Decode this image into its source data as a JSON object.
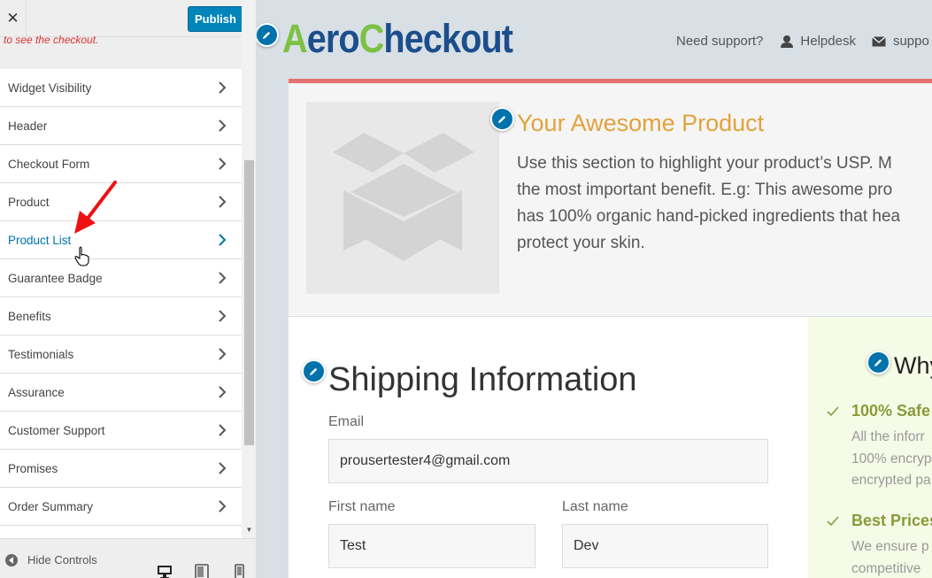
{
  "sidebar": {
    "close_label": "✕",
    "publish_label": "Publish",
    "notice": "to see the checkout.",
    "items": [
      {
        "label": "Widget Visibility"
      },
      {
        "label": "Header"
      },
      {
        "label": "Checkout Form"
      },
      {
        "label": "Product"
      },
      {
        "label": "Product List",
        "active": true
      },
      {
        "label": "Guarantee Badge"
      },
      {
        "label": "Benefits"
      },
      {
        "label": "Testimonials"
      },
      {
        "label": "Assurance"
      },
      {
        "label": "Customer Support"
      },
      {
        "label": "Promises"
      },
      {
        "label": "Order Summary"
      }
    ],
    "hide_controls": "Hide Controls",
    "devices": [
      "desktop-icon",
      "tablet-icon",
      "mobile-icon"
    ]
  },
  "preview": {
    "logo": {
      "first": "A",
      "mid": "ero",
      "accent": "C",
      "rest": "heckout"
    },
    "top_links": {
      "support_question": "Need support?",
      "helpdesk": "Helpdesk",
      "support": "suppo"
    },
    "product": {
      "title": "Your Awesome Product",
      "desc_lines": [
        "Use this section to highlight your product’s USP. M",
        "the most important benefit. E.g: This awesome pro",
        "has 100% organic hand-picked ingredients that hea",
        "protect your skin."
      ]
    },
    "shipping": {
      "title": "Shipping Information",
      "email_label": "Email",
      "email_value": "prousertester4@gmail.com",
      "first_name_label": "First name",
      "first_name_value": "Test",
      "last_name_label": "Last name",
      "last_name_value": "Dev"
    },
    "why": {
      "title": "Why",
      "benefits": [
        {
          "title": "100% Safe",
          "lines": [
            "All the inforr",
            "100% encryp",
            "encrypted pa"
          ]
        },
        {
          "title": "Best Prices",
          "lines": [
            "We ensure p",
            "competitive"
          ]
        }
      ]
    }
  },
  "colors": {
    "accent_blue": "#0085ba",
    "link_blue": "#0073aa",
    "product_title": "#e2a23b",
    "benefit_title": "#8a9a3b",
    "logo_green": "#7cc143",
    "logo_blue": "#1c4e8c",
    "top_border": "#e57373"
  }
}
